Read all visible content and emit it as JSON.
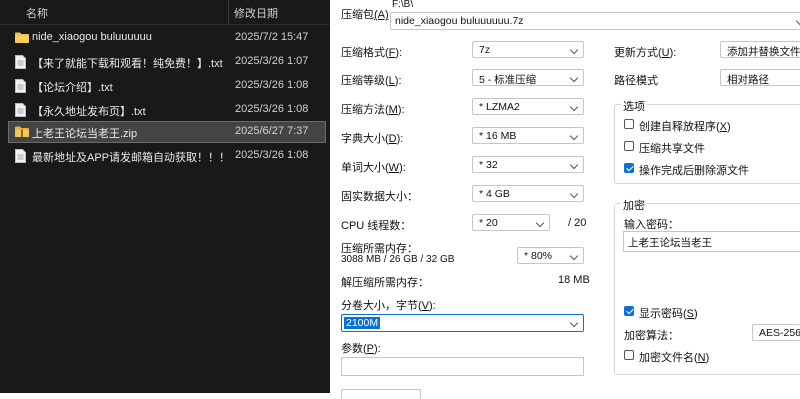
{
  "explorer": {
    "col_name": "名称",
    "col_date": "修改日期",
    "rows": [
      {
        "name": "nide_xiaogou  buluuuuuu",
        "date": "2025/7/2 15:47",
        "icon": "folder-icon"
      },
      {
        "name": "【来了就能下载和观看！纯免费！】.txt",
        "date": "2025/3/26 1:07",
        "icon": "text-file-icon"
      },
      {
        "name": "【论坛介绍】.txt",
        "date": "2025/3/26 1:08",
        "icon": "text-file-icon"
      },
      {
        "name": "【永久地址发布页】.txt",
        "date": "2025/3/26 1:08",
        "icon": "text-file-icon"
      },
      {
        "name": "上老王论坛当老王.zip",
        "date": "2025/6/27 7:37",
        "icon": "zip-file-icon",
        "selected": true
      },
      {
        "name": "最新地址及APP请发邮箱自动获取！！！....",
        "date": "2025/3/26 1:08",
        "icon": "text-file-icon"
      }
    ]
  },
  "dialog": {
    "archive_label": "压缩包",
    "archive_key": "(A)",
    "archive_path": "F:\\B\\",
    "archive_name": "nide_xiaogou  buluuuuuu.7z",
    "format_label": "压缩格式(",
    "format_key": "F",
    "format_tail": "):",
    "format_value": "7z",
    "level_label": "压缩等级(",
    "level_key": "L",
    "level_tail": "):",
    "level_value": "5 - 标准压缩",
    "method_label": "压缩方法(",
    "method_key": "M",
    "method_tail": "):",
    "method_value": "* LZMA2",
    "dict_label": "字典大小(",
    "dict_key": "D",
    "dict_tail": "):",
    "dict_value": "* 16 MB",
    "word_label": "单词大小(",
    "word_key": "W",
    "word_tail": "):",
    "word_value": "* 32",
    "solid_label": "固实数据大小：",
    "solid_value": "* 4 GB",
    "cpu_label": "CPU 线程数：",
    "cpu_value": "* 20",
    "cpu_total": "/ 20",
    "mem_compress_label": "压缩所需内存：",
    "mem_compress_detail": "3088 MB / 26 GB / 32 GB",
    "mem_percent": "* 80%",
    "mem_decompress_label": "解压缩所需内存：",
    "mem_decompress_value": "18 MB",
    "split_label": "分卷大小，字节(",
    "split_key": "V",
    "split_tail": "):",
    "split_value": "2100M",
    "params_label": "参数(",
    "params_key": "P",
    "params_tail": "):",
    "update_label": "更新方式(",
    "update_key": "U",
    "update_tail": "):",
    "update_value": "添加并替换文件",
    "path_label": "路径模式",
    "path_value": "相对路径",
    "options_title": "选项",
    "opt_sfx": "创建自释放程序(",
    "opt_sfx_key": "X",
    "opt_sfx_tail": ")",
    "opt_sfx_checked": false,
    "opt_shared": "压缩共享文件",
    "opt_shared_checked": false,
    "opt_delete": "操作完成后删除源文件",
    "opt_delete_checked": true,
    "encrypt_title": "加密",
    "password_label": "输入密码：",
    "password_value": "上老王论坛当老王",
    "show_pw": "显示密码(",
    "show_pw_key": "S",
    "show_pw_tail": ")",
    "show_pw_checked": true,
    "enc_method_label": "加密算法：",
    "enc_method_value": "AES-256",
    "enc_names": "加密文件名(",
    "enc_names_key": "N",
    "enc_names_tail": ")",
    "enc_names_checked": false
  },
  "colors": {
    "explorer_bg": "#191919",
    "accent": "#0b6fd6",
    "selection": "#444444"
  }
}
